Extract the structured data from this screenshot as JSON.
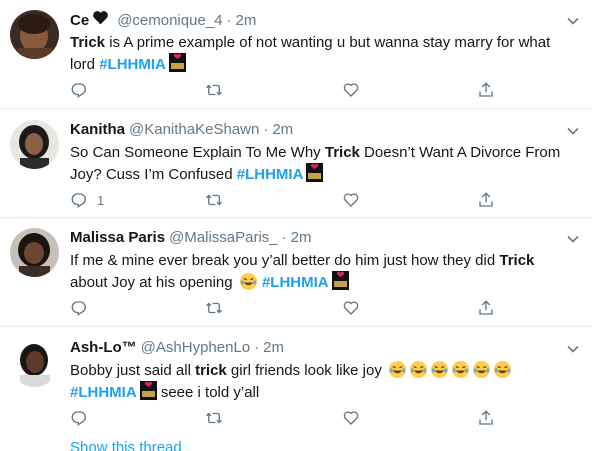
{
  "tweets": [
    {
      "name": "Ce",
      "handle": "@cemonique_4",
      "time": "2m",
      "text_parts": [
        "Trick",
        " is A prime example of not wanting u but wanna stay marry for what lord "
      ],
      "hashtag": "#LHHMIA",
      "reply_count": "",
      "avatar_icon": "avatar-photo"
    },
    {
      "name": "Kanitha",
      "handle": "@KanithaKeShawn",
      "time": "2m",
      "line1_a": "So Can Someone Explain To Me Why ",
      "line1_b": "Trick",
      "line1_c": " Doesn’t Want A Divorce From",
      "line2": "Joy? Cuss I’m Confused ",
      "hashtag": "#LHHMIA",
      "reply_count": "1",
      "avatar_icon": "avatar-photo"
    },
    {
      "name": "Malissa Paris",
      "handle": "@MalissaParis_",
      "time": "2m",
      "line1_a": "If me & mine ever break you y’all better do him just how they did ",
      "line1_b": "Trick",
      "line2": "about Joy at his opening ",
      "hashtag": "#LHHMIA",
      "reply_count": "",
      "avatar_icon": "avatar-photo"
    },
    {
      "name": "Ash-Lo™",
      "handle": "@AshHyphenLo",
      "time": "2m",
      "line1_a": "Bobby just said all ",
      "line1_b": "trick",
      "line1_c": " girl friends look like joy ",
      "hashtag": "#LHHMIA",
      "line2_after": " seee i told y’all",
      "reply_count": "",
      "avatar_icon": "avatar-photo"
    }
  ],
  "show_thread": "Show this thread",
  "icons": {
    "reply": "reply-icon",
    "retweet": "retweet-icon",
    "like": "like-icon",
    "share": "share-icon",
    "caret": "chevron-down-icon",
    "badge": "lhh-badge-icon",
    "emoji": "laughing-emoji-icon"
  },
  "colors": {
    "hashtag": "#1da1f2",
    "secondary_text": "#657786",
    "divider": "#e6ecf0"
  }
}
